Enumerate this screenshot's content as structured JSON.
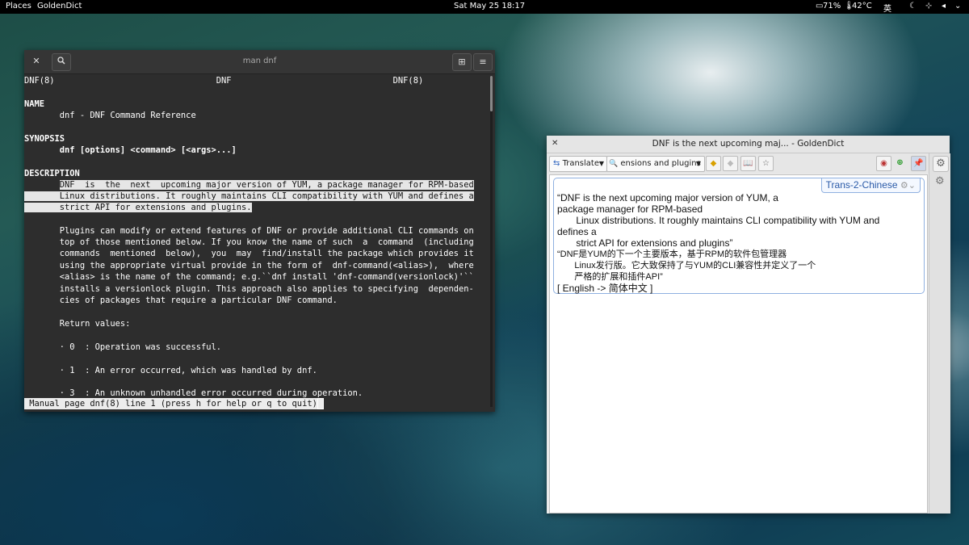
{
  "topbar": {
    "places": "Places",
    "app": "GoldenDict",
    "clock": "Sat May 25  18:17",
    "battery": "71%",
    "temp": "42°C",
    "ime": "英"
  },
  "terminal": {
    "title": "man dnf",
    "lines": [
      "DNF(8)                                DNF                                DNF(8)",
      "",
      "NAME",
      "       dnf - DNF Command Reference",
      "",
      "SYNOPSIS",
      "       dnf [options] <command> [<args>...]",
      "",
      "DESCRIPTION",
      "       DNF  is  the  next  upcoming major version of YUM, a package manager for RPM-based",
      "       Linux distributions. It roughly maintains CLI compatibility with YUM and defines a",
      "       strict API for extensions and plugins.",
      "",
      "       Plugins can modify or extend features of DNF or provide additional CLI commands on",
      "       top of those mentioned below. If you know the name of such  a  command  (including",
      "       commands  mentioned  below),  you  may  find/install the package which provides it",
      "       using the appropriate virtual provide in the form of  dnf-command(<alias>),  where",
      "       <alias> is the name of the command; e.g.``dnf install 'dnf-command(versionlock)'``",
      "       installs a versionlock plugin. This approach also applies to specifying  dependen-",
      "       cies of packages that require a particular DNF command.",
      "",
      "       Return values:",
      "",
      "       · 0  : Operation was successful.",
      "",
      "       · 1  : An error occurred, which was handled by dnf.",
      "",
      "       · 3  : An unknown unhandled error occurred during operation."
    ],
    "status": " Manual page dnf(8) line 1 (press h for help or q to quit)"
  },
  "goldendict": {
    "title": "DNF is the next upcoming maj... - GoldenDict",
    "translate_label": "Translate",
    "search_value": "ensions and plugins",
    "dictionary_name": "Trans-2-Chinese",
    "article_lines": [
      "“DNF is the next upcoming major version of YUM, a",
      "package manager for RPM-based",
      "       Linux distributions. It roughly maintains CLI compatibility with YUM and",
      "defines a",
      "       strict API for extensions and plugins”",
      "“DNF是YUM的下一个主要版本，基于RPM的软件包管理器",
      "       Linux发行版。它大致保持了与YUM的CLI兼容性并定义了一个",
      "       严格的扩展和插件API”",
      "[ English -> 简体中文 ]"
    ]
  }
}
